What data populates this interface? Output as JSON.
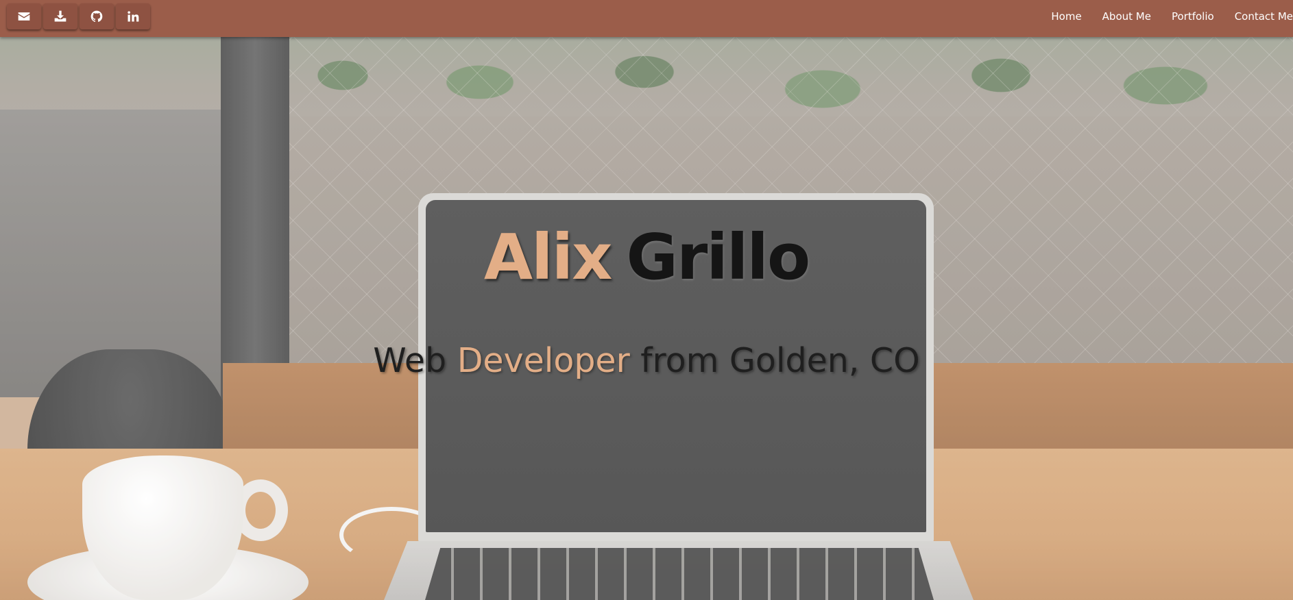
{
  "navbar": {
    "icons": [
      {
        "name": "envelope-icon",
        "label": "Email"
      },
      {
        "name": "download-icon",
        "label": "Download resume"
      },
      {
        "name": "github-icon",
        "label": "GitHub"
      },
      {
        "name": "linkedin-icon",
        "label": "LinkedIn"
      }
    ],
    "links": [
      "Home",
      "About Me",
      "Portfolio",
      "Contact Me"
    ],
    "colors": {
      "background": "#9b5d4a",
      "button": "#8e5242",
      "text": "#ffffff"
    }
  },
  "hero": {
    "first_name": "Alix",
    "last_name": "Grillo",
    "subtitle_prefix": "Web",
    "subtitle_accent": "Developer",
    "subtitle_suffix": "from Golden, CO",
    "colors": {
      "accent": "#e3ae87",
      "dark_text": "#151515"
    }
  }
}
